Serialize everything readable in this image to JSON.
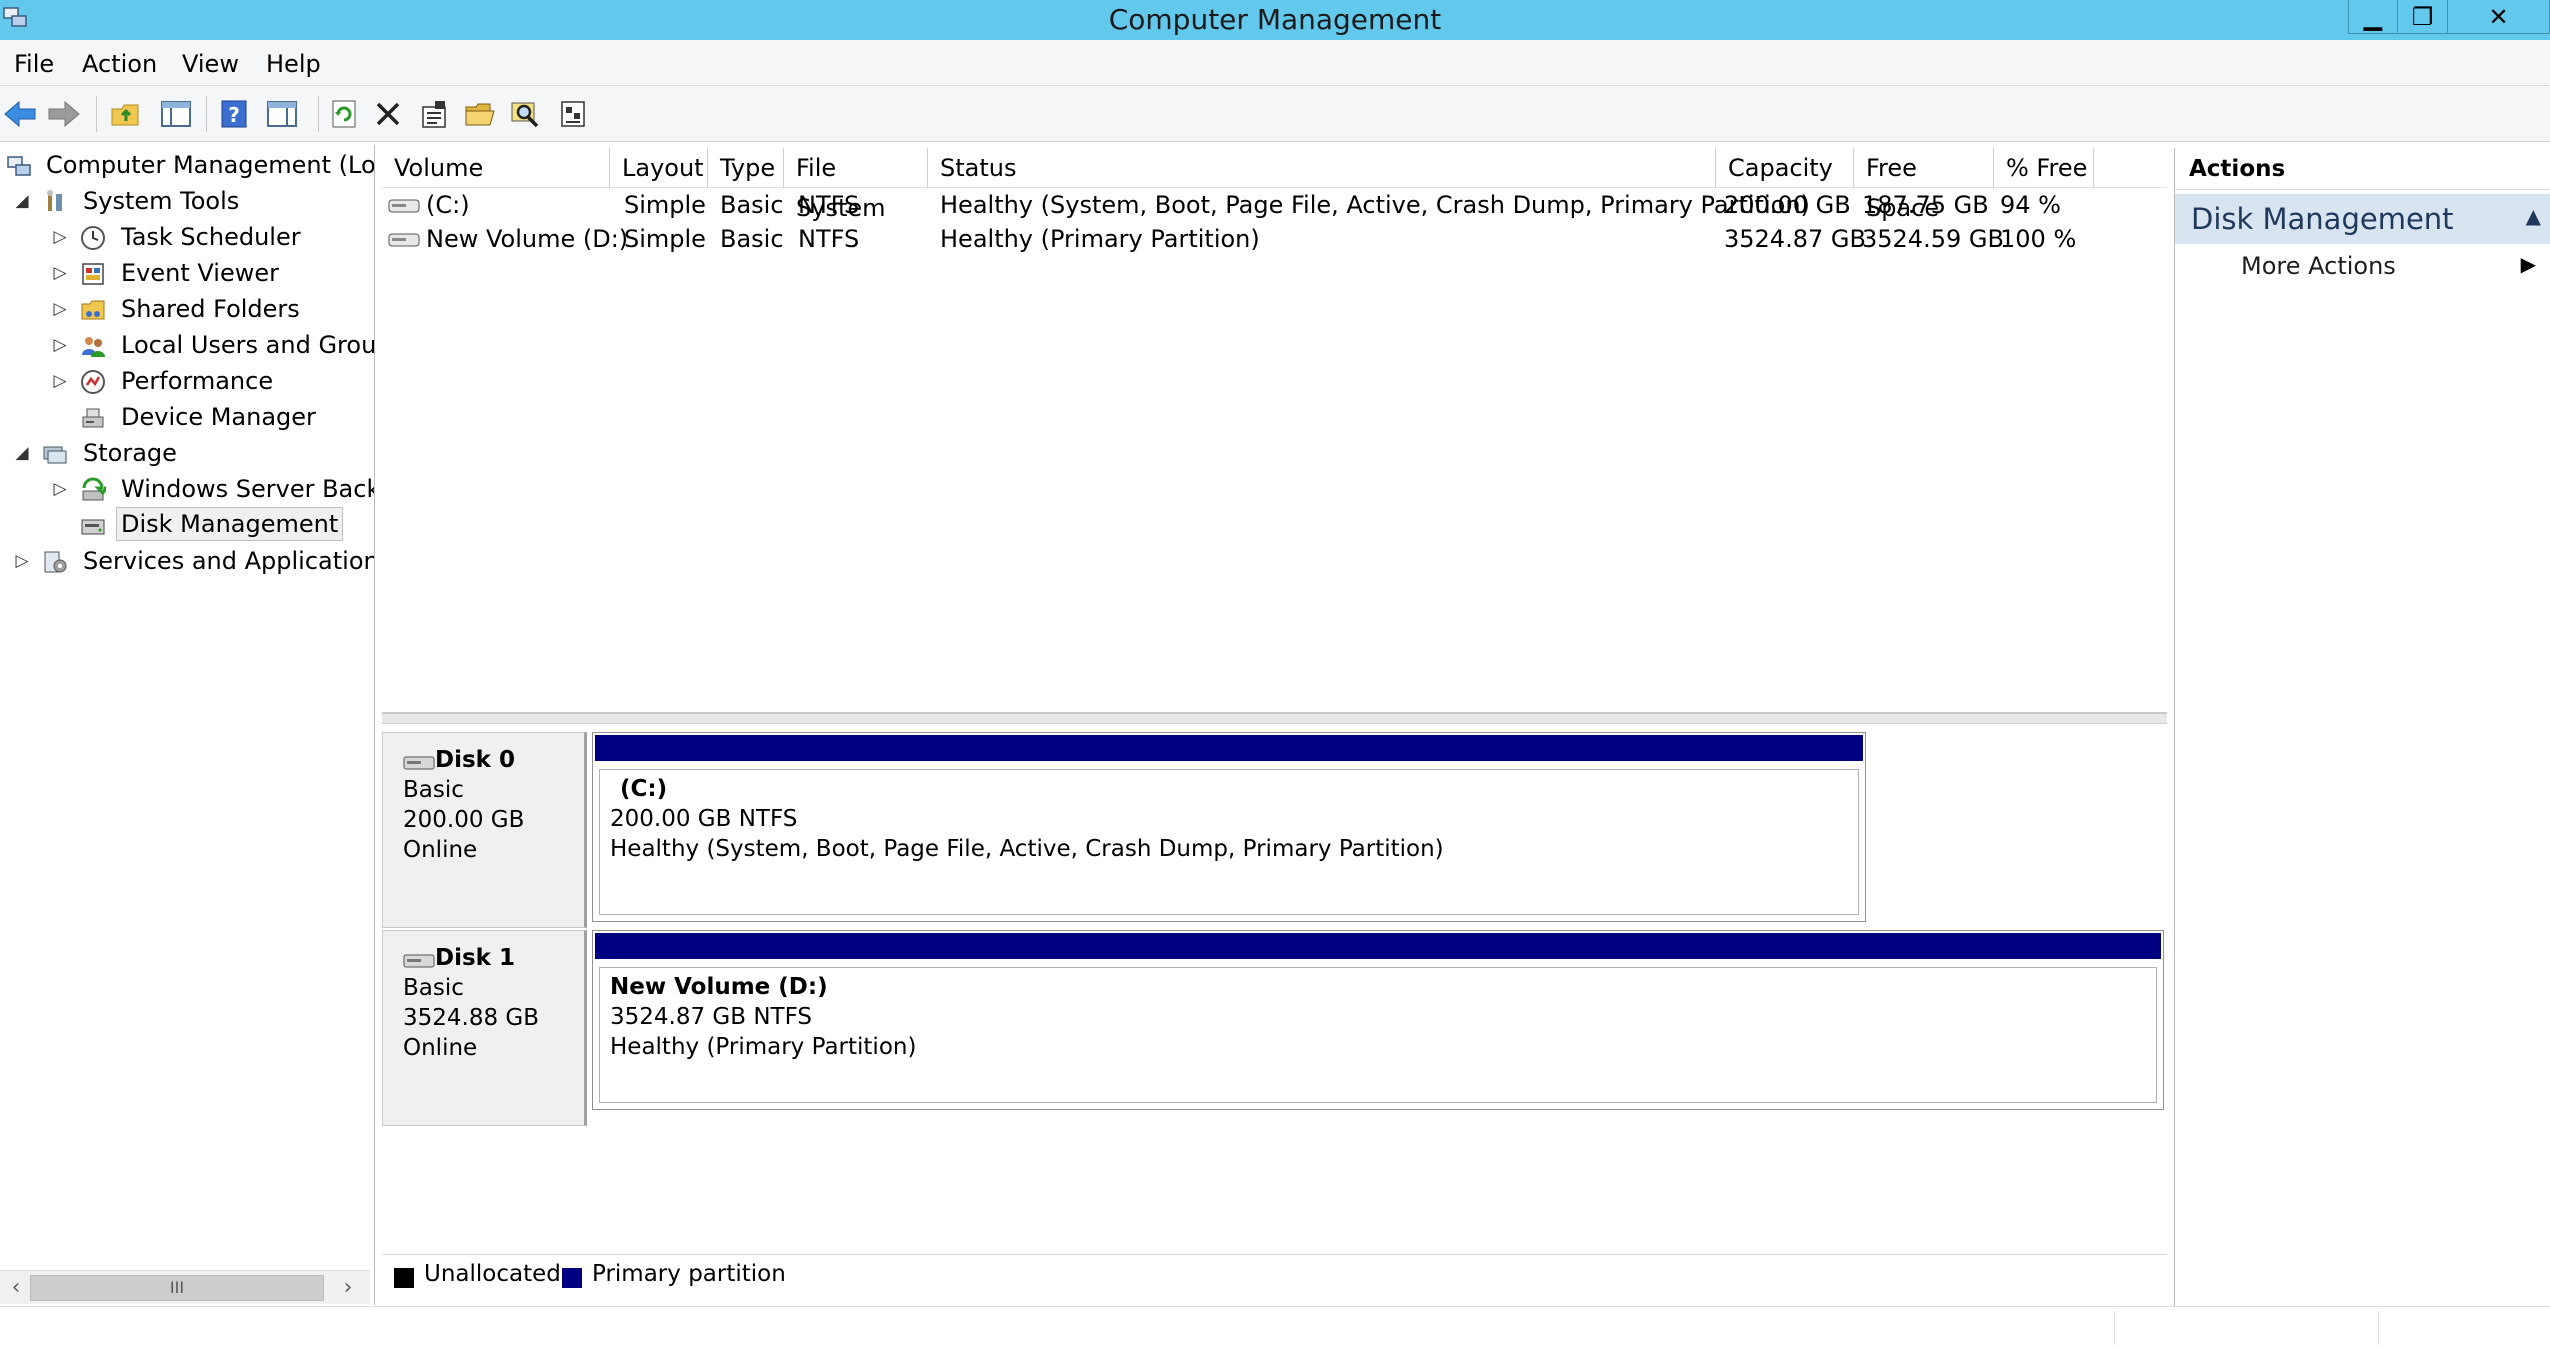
{
  "window": {
    "title": "Computer Management",
    "controls": {
      "minimize": "▁",
      "maximize": "❐",
      "close": "✕"
    }
  },
  "menu": [
    "File",
    "Action",
    "View",
    "Help"
  ],
  "toolbar": {
    "icons": [
      "back-arrow-icon",
      "forward-arrow-icon",
      "up-folder-icon",
      "show-hide-tree-icon",
      "help-icon",
      "show-hide-action-pane-icon",
      "refresh-icon",
      "delete-icon",
      "properties-icon",
      "open-folder-icon",
      "search-icon",
      "settings-icon"
    ]
  },
  "tree": {
    "items": [
      {
        "label": "Computer Management (Local",
        "level": 0,
        "expander": ""
      },
      {
        "label": "System Tools",
        "level": 1,
        "expander": "◢"
      },
      {
        "label": "Task Scheduler",
        "level": 2,
        "expander": "▷"
      },
      {
        "label": "Event Viewer",
        "level": 2,
        "expander": "▷"
      },
      {
        "label": "Shared Folders",
        "level": 2,
        "expander": "▷"
      },
      {
        "label": "Local Users and Groups",
        "level": 2,
        "expander": "▷"
      },
      {
        "label": "Performance",
        "level": 2,
        "expander": "▷"
      },
      {
        "label": "Device Manager",
        "level": 2,
        "expander": ""
      },
      {
        "label": "Storage",
        "level": 1,
        "expander": "◢"
      },
      {
        "label": "Windows Server Backup",
        "level": 2,
        "expander": "▷"
      },
      {
        "label": "Disk Management",
        "level": 2,
        "expander": "",
        "selected": true
      },
      {
        "label": "Services and Applications",
        "level": 1,
        "expander": "▷"
      }
    ],
    "scroll_thumb": "III"
  },
  "volumes": {
    "columns": [
      "Volume",
      "Layout",
      "Type",
      "File System",
      "Status",
      "Capacity",
      "Free Space",
      "% Free"
    ],
    "rows": [
      [
        "(C:)",
        "Simple",
        "Basic",
        "NTFS",
        "Healthy (System, Boot, Page File, Active, Crash Dump, Primary Partition)",
        "200.00 GB",
        "187.75 GB",
        "94 %"
      ],
      [
        "New Volume (D:)",
        "Simple",
        "Basic",
        "NTFS",
        "Healthy (Primary Partition)",
        "3524.87 GB",
        "3524.59 GB",
        "100 %"
      ]
    ]
  },
  "disks": [
    {
      "name": "Disk 0",
      "type": "Basic",
      "size": "200.00 GB",
      "state": "Online",
      "partition": {
        "name": "(C:)",
        "size_fs": "200.00 GB NTFS",
        "status": "Healthy (System, Boot, Page File, Active, Crash Dump, Primary Partition)"
      }
    },
    {
      "name": "Disk 1",
      "type": "Basic",
      "size": "3524.88 GB",
      "state": "Online",
      "partition": {
        "name": "New Volume  (D:)",
        "size_fs": "3524.87 GB NTFS",
        "status": "Healthy (Primary Partition)"
      }
    }
  ],
  "legend": {
    "items": [
      {
        "label": "Unallocated",
        "color": "#000000"
      },
      {
        "label": "Primary partition",
        "color": "#000080"
      }
    ]
  },
  "actions": {
    "title": "Actions",
    "section": "Disk Management",
    "more": "More Actions"
  },
  "colors": {
    "titlebar": "#63c9ec",
    "partition_bar": "#000080",
    "action_section": "#d9e4f1"
  }
}
